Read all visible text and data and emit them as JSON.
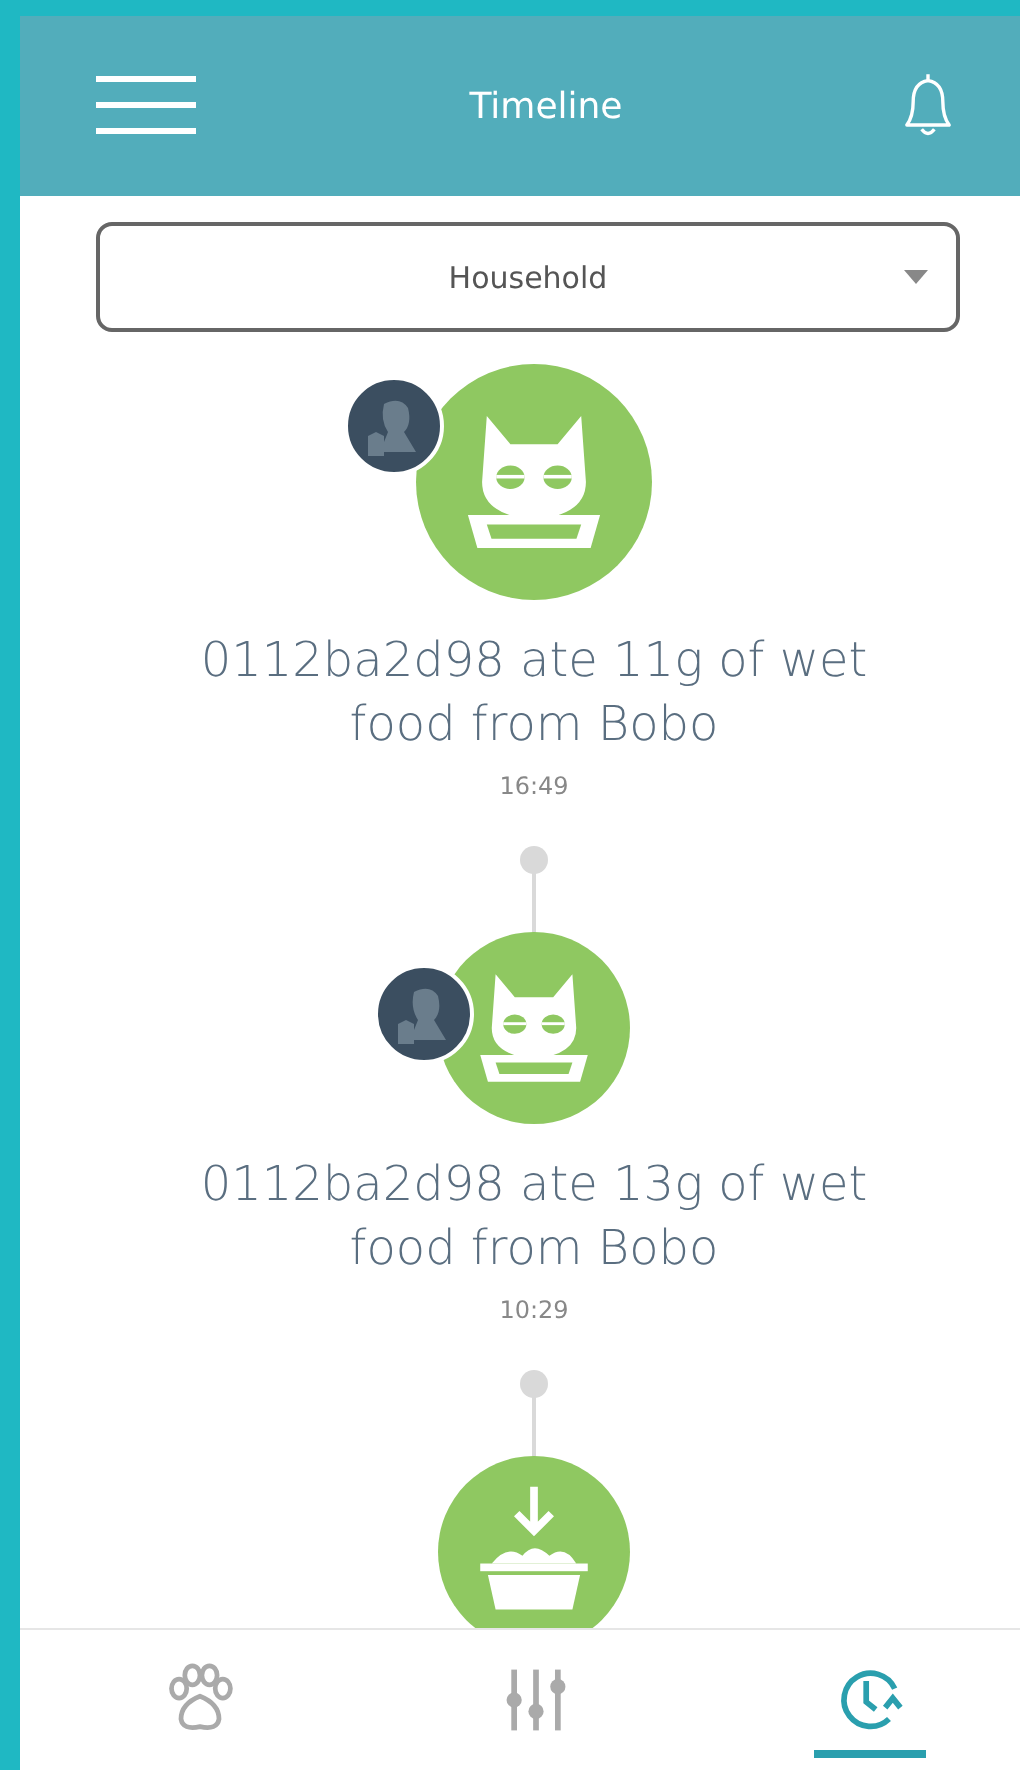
{
  "header": {
    "title": "Timeline"
  },
  "filter": {
    "value": "Household"
  },
  "events": [
    {
      "kind": "fed",
      "text": "0112ba2d98 ate 11g of wet food from Bobo",
      "time": "16:49"
    },
    {
      "kind": "fed",
      "text": "0112ba2d98 ate 13g of wet food from Bobo",
      "time": "10:29"
    },
    {
      "kind": "refill"
    }
  ],
  "nav": [
    {
      "kind": "pets",
      "selected": false
    },
    {
      "kind": "controls",
      "selected": false
    },
    {
      "kind": "timeline",
      "selected": true
    }
  ]
}
